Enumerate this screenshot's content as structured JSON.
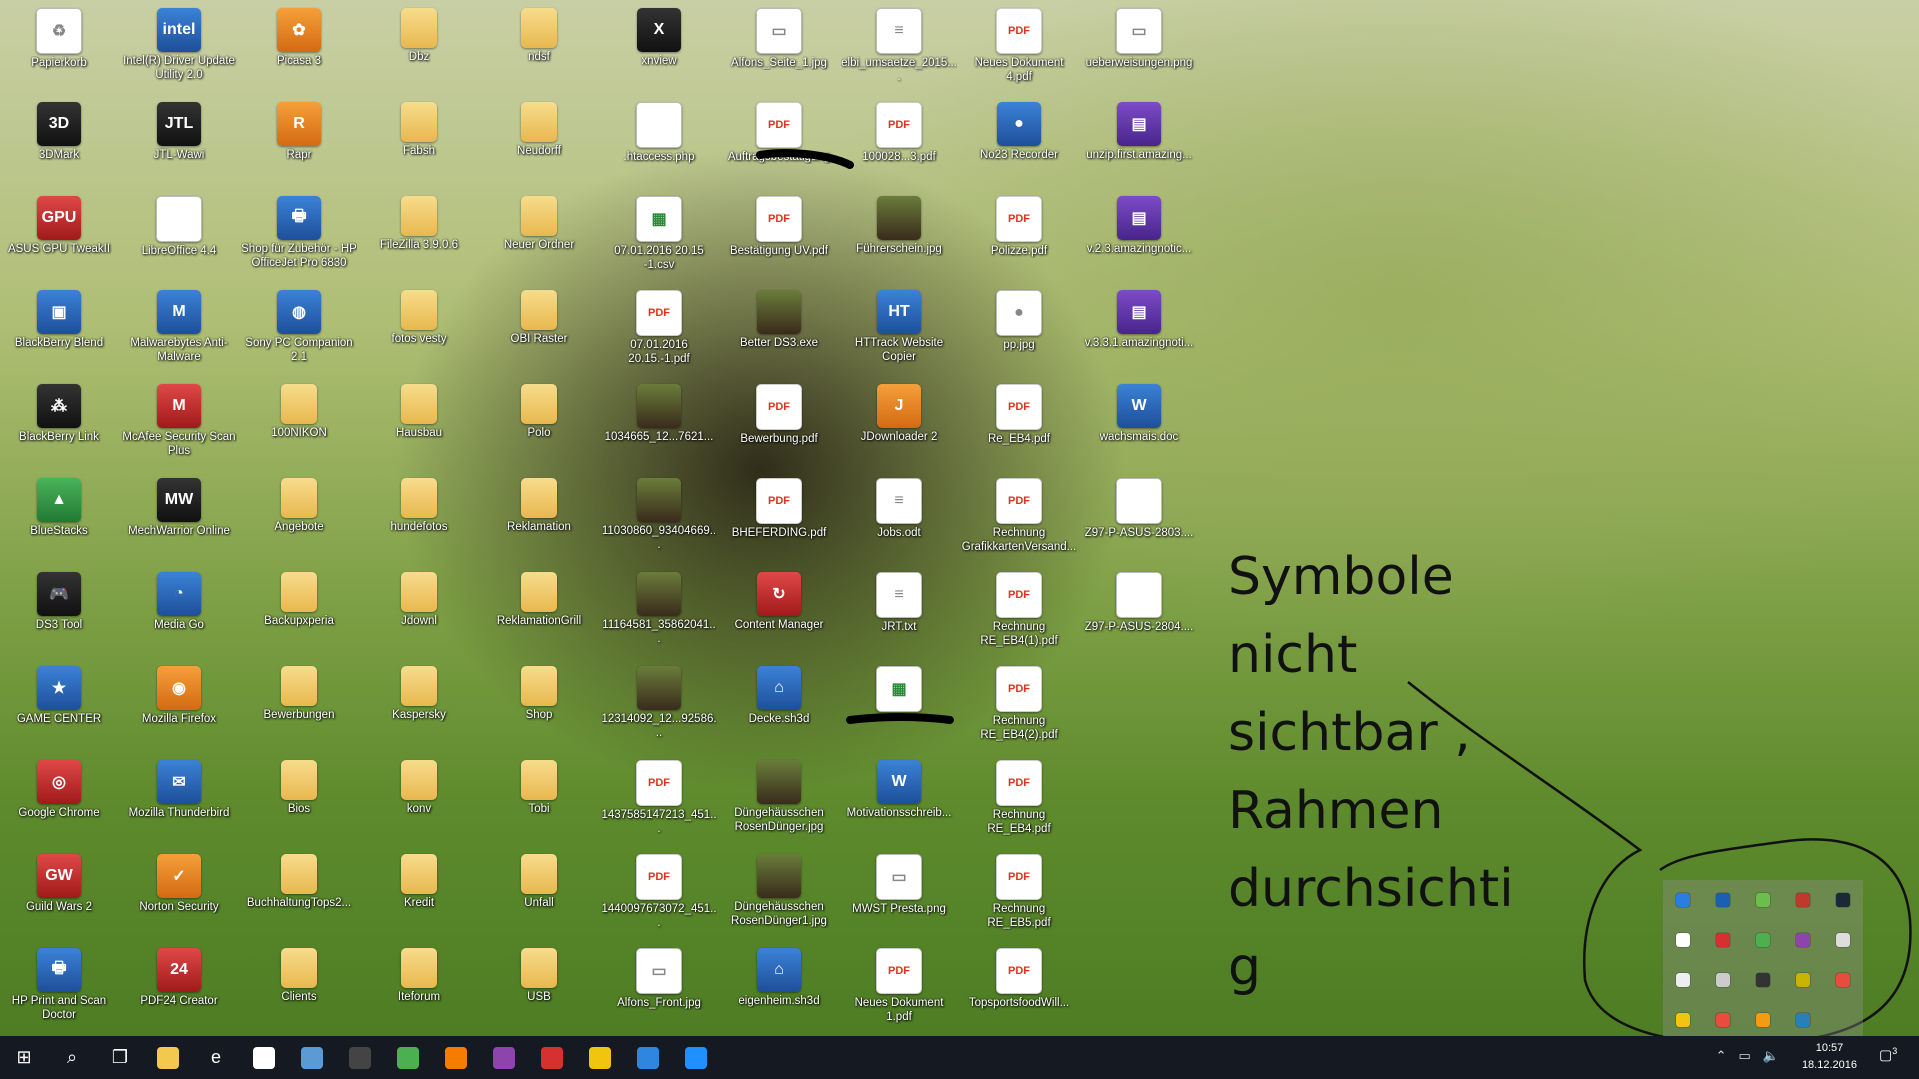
{
  "desktop": {
    "icons": [
      {
        "label": "Papierkorb",
        "col": 0,
        "row": 0,
        "kind": "g-doc",
        "glyph": "♻"
      },
      {
        "label": "Intel(R) Driver Update Utility 2.0",
        "col": 1,
        "row": 0,
        "kind": "g-app",
        "glyph": "intel"
      },
      {
        "label": "Picasa 3",
        "col": 2,
        "row": 0,
        "kind": "g-orange",
        "glyph": "✿"
      },
      {
        "label": "Dbz",
        "col": 3,
        "row": 0,
        "kind": "g-folder",
        "glyph": ""
      },
      {
        "label": "ndsf",
        "col": 4,
        "row": 0,
        "kind": "g-folder",
        "glyph": ""
      },
      {
        "label": "xnview",
        "col": 5,
        "row": 0,
        "kind": "g-dark",
        "glyph": "X"
      },
      {
        "label": "Alfons_Seite_1.jpg",
        "col": 6,
        "row": 0,
        "kind": "g-doc",
        "glyph": "▭"
      },
      {
        "label": "elbi_umsaetze_2015....",
        "col": 7,
        "row": 0,
        "kind": "g-doc",
        "glyph": "≡"
      },
      {
        "label": "Neues Dokument 4.pdf",
        "col": 8,
        "row": 0,
        "kind": "g-pdf",
        "glyph": "PDF"
      },
      {
        "label": "ueberweisungen.png",
        "col": 9,
        "row": 0,
        "kind": "g-doc",
        "glyph": "▭"
      },
      {
        "label": "3DMark",
        "col": 0,
        "row": 1,
        "kind": "g-dark",
        "glyph": "3D"
      },
      {
        "label": "JTL-Wawi",
        "col": 1,
        "row": 1,
        "kind": "g-dark",
        "glyph": "JTL"
      },
      {
        "label": "Rapr",
        "col": 2,
        "row": 1,
        "kind": "g-orange",
        "glyph": "R"
      },
      {
        "label": "Fabsh",
        "col": 3,
        "row": 1,
        "kind": "g-folder",
        "glyph": ""
      },
      {
        "label": "Neudorff",
        "col": 4,
        "row": 1,
        "kind": "g-folder",
        "glyph": ""
      },
      {
        "label": ".htaccess.php",
        "col": 5,
        "row": 1,
        "kind": "g-doc",
        "glyph": ""
      },
      {
        "label": "Auftragsbestätigung",
        "col": 6,
        "row": 1,
        "kind": "g-pdf",
        "glyph": "PDF"
      },
      {
        "label": "100028...3.pdf",
        "col": 7,
        "row": 1,
        "kind": "g-pdf",
        "glyph": "PDF"
      },
      {
        "label": "No23 Recorder",
        "col": 8,
        "row": 1,
        "kind": "g-app",
        "glyph": "●"
      },
      {
        "label": "unzip.first.amazing...",
        "col": 9,
        "row": 1,
        "kind": "g-purple",
        "glyph": "▤"
      },
      {
        "label": "ASUS GPU TweakII",
        "col": 0,
        "row": 2,
        "kind": "g-red",
        "glyph": "GPU"
      },
      {
        "label": "LibreOffice 4.4",
        "col": 1,
        "row": 2,
        "kind": "g-doc",
        "glyph": ""
      },
      {
        "label": "Shop für Zubehör - HP OfficeJet Pro 6830",
        "col": 2,
        "row": 2,
        "kind": "g-app",
        "glyph": "🖶"
      },
      {
        "label": "FileZilla 3.9.0.6",
        "col": 3,
        "row": 2,
        "kind": "g-folder",
        "glyph": ""
      },
      {
        "label": "Neuer Ordner",
        "col": 4,
        "row": 2,
        "kind": "g-folder",
        "glyph": ""
      },
      {
        "label": "07.01.2016 20.15 -1.csv",
        "col": 5,
        "row": 2,
        "kind": "g-sheet",
        "glyph": "▦"
      },
      {
        "label": "Bestätigung UV.pdf",
        "col": 6,
        "row": 2,
        "kind": "g-pdf",
        "glyph": "PDF"
      },
      {
        "label": "Führerschein.jpg",
        "col": 7,
        "row": 2,
        "kind": "g-img",
        "glyph": ""
      },
      {
        "label": "Polizze.pdf",
        "col": 8,
        "row": 2,
        "kind": "g-pdf",
        "glyph": "PDF"
      },
      {
        "label": "v.2.3.amazingnotic...",
        "col": 9,
        "row": 2,
        "kind": "g-purple",
        "glyph": "▤"
      },
      {
        "label": "BlackBerry Blend",
        "col": 0,
        "row": 3,
        "kind": "g-app",
        "glyph": "▣"
      },
      {
        "label": "Malwarebytes Anti-Malware",
        "col": 1,
        "row": 3,
        "kind": "g-app",
        "glyph": "M"
      },
      {
        "label": "Sony PC Companion 2.1",
        "col": 2,
        "row": 3,
        "kind": "g-app",
        "glyph": "◍"
      },
      {
        "label": "fotos vesty",
        "col": 3,
        "row": 3,
        "kind": "g-folder",
        "glyph": ""
      },
      {
        "label": "OBI Raster",
        "col": 4,
        "row": 3,
        "kind": "g-folder",
        "glyph": ""
      },
      {
        "label": "07.01.2016 20.15.-1.pdf",
        "col": 5,
        "row": 3,
        "kind": "g-pdf",
        "glyph": "PDF"
      },
      {
        "label": "Better DS3.exe",
        "col": 6,
        "row": 3,
        "kind": "g-img",
        "glyph": ""
      },
      {
        "label": "HTTrack Website Copier",
        "col": 7,
        "row": 3,
        "kind": "g-app",
        "glyph": "HT"
      },
      {
        "label": "pp.jpg",
        "col": 8,
        "row": 3,
        "kind": "g-doc",
        "glyph": "●"
      },
      {
        "label": "v.3.3.1.amazingnoti...",
        "col": 9,
        "row": 3,
        "kind": "g-purple",
        "glyph": "▤"
      },
      {
        "label": "BlackBerry Link",
        "col": 0,
        "row": 4,
        "kind": "g-dark",
        "glyph": "⁂"
      },
      {
        "label": "McAfee Security Scan Plus",
        "col": 1,
        "row": 4,
        "kind": "g-red",
        "glyph": "M"
      },
      {
        "label": "100NIKON",
        "col": 2,
        "row": 4,
        "kind": "g-folder",
        "glyph": ""
      },
      {
        "label": "Hausbau",
        "col": 3,
        "row": 4,
        "kind": "g-folder",
        "glyph": ""
      },
      {
        "label": "Polo",
        "col": 4,
        "row": 4,
        "kind": "g-folder",
        "glyph": ""
      },
      {
        "label": "1034665_12...7621...",
        "col": 5,
        "row": 4,
        "kind": "g-img",
        "glyph": ""
      },
      {
        "label": "Bewerbung.pdf",
        "col": 6,
        "row": 4,
        "kind": "g-pdf",
        "glyph": "PDF"
      },
      {
        "label": "JDownloader 2",
        "col": 7,
        "row": 4,
        "kind": "g-orange",
        "glyph": "J"
      },
      {
        "label": "Re_EB4.pdf",
        "col": 8,
        "row": 4,
        "kind": "g-pdf",
        "glyph": "PDF"
      },
      {
        "label": "wachsmais.doc",
        "col": 9,
        "row": 4,
        "kind": "g-app",
        "glyph": "W"
      },
      {
        "label": "BlueStacks",
        "col": 0,
        "row": 5,
        "kind": "g-green",
        "glyph": "▲"
      },
      {
        "label": "MechWarrior Online",
        "col": 1,
        "row": 5,
        "kind": "g-dark",
        "glyph": "MW"
      },
      {
        "label": "Angebote",
        "col": 2,
        "row": 5,
        "kind": "g-folder",
        "glyph": ""
      },
      {
        "label": "hundefotos",
        "col": 3,
        "row": 5,
        "kind": "g-folder",
        "glyph": ""
      },
      {
        "label": "Reklamation",
        "col": 4,
        "row": 5,
        "kind": "g-folder",
        "glyph": ""
      },
      {
        "label": "11030860_93404669...",
        "col": 5,
        "row": 5,
        "kind": "g-img",
        "glyph": ""
      },
      {
        "label": "BHEFERDING.pdf",
        "col": 6,
        "row": 5,
        "kind": "g-pdf",
        "glyph": "PDF"
      },
      {
        "label": "Jobs.odt",
        "col": 7,
        "row": 5,
        "kind": "g-doc",
        "glyph": "≡"
      },
      {
        "label": "Rechnung GrafikkartenVersand...",
        "col": 8,
        "row": 5,
        "kind": "g-pdf",
        "glyph": "PDF"
      },
      {
        "label": "Z97-P-ASUS-2803....",
        "col": 9,
        "row": 5,
        "kind": "g-doc",
        "glyph": ""
      },
      {
        "label": "DS3 Tool",
        "col": 0,
        "row": 6,
        "kind": "g-dark",
        "glyph": "🎮"
      },
      {
        "label": "Media Go",
        "col": 1,
        "row": 6,
        "kind": "g-app",
        "glyph": "◔"
      },
      {
        "label": "Backupxperia",
        "col": 2,
        "row": 6,
        "kind": "g-folder",
        "glyph": ""
      },
      {
        "label": "Jdownl",
        "col": 3,
        "row": 6,
        "kind": "g-folder",
        "glyph": ""
      },
      {
        "label": "ReklamationGrill",
        "col": 4,
        "row": 6,
        "kind": "g-folder",
        "glyph": ""
      },
      {
        "label": "11164581_35862041...",
        "col": 5,
        "row": 6,
        "kind": "g-img",
        "glyph": ""
      },
      {
        "label": "Content Manager",
        "col": 6,
        "row": 6,
        "kind": "g-red",
        "glyph": "↻"
      },
      {
        "label": "JRT.txt",
        "col": 7,
        "row": 6,
        "kind": "g-doc",
        "glyph": "≡"
      },
      {
        "label": "Rechnung RE_EB4(1).pdf",
        "col": 8,
        "row": 6,
        "kind": "g-pdf",
        "glyph": "PDF"
      },
      {
        "label": "Z97-P-ASUS-2804....",
        "col": 9,
        "row": 6,
        "kind": "g-doc",
        "glyph": ""
      },
      {
        "label": "GAME CENTER",
        "col": 0,
        "row": 7,
        "kind": "g-app",
        "glyph": "★"
      },
      {
        "label": "Mozilla Firefox",
        "col": 1,
        "row": 7,
        "kind": "g-orange",
        "glyph": "◉"
      },
      {
        "label": "Bewerbungen",
        "col": 2,
        "row": 7,
        "kind": "g-folder",
        "glyph": ""
      },
      {
        "label": "Kaspersky",
        "col": 3,
        "row": 7,
        "kind": "g-folder",
        "glyph": ""
      },
      {
        "label": "Shop",
        "col": 4,
        "row": 7,
        "kind": "g-folder",
        "glyph": ""
      },
      {
        "label": "12314092_12...92586...",
        "col": 5,
        "row": 7,
        "kind": "g-img",
        "glyph": ""
      },
      {
        "label": "Decke.sh3d",
        "col": 6,
        "row": 7,
        "kind": "g-app",
        "glyph": "⌂"
      },
      {
        "label": "",
        "col": 7,
        "row": 7,
        "kind": "g-sheet",
        "glyph": "▦"
      },
      {
        "label": "Rechnung RE_EB4(2).pdf",
        "col": 8,
        "row": 7,
        "kind": "g-pdf",
        "glyph": "PDF"
      },
      {
        "label": "Google Chrome",
        "col": 0,
        "row": 8,
        "kind": "g-red",
        "glyph": "◎"
      },
      {
        "label": "Mozilla Thunderbird",
        "col": 1,
        "row": 8,
        "kind": "g-app",
        "glyph": "✉"
      },
      {
        "label": "Bios",
        "col": 2,
        "row": 8,
        "kind": "g-folder",
        "glyph": ""
      },
      {
        "label": "konv",
        "col": 3,
        "row": 8,
        "kind": "g-folder",
        "glyph": ""
      },
      {
        "label": "Tobi",
        "col": 4,
        "row": 8,
        "kind": "g-folder",
        "glyph": ""
      },
      {
        "label": "1437585147213_451...",
        "col": 5,
        "row": 8,
        "kind": "g-pdf",
        "glyph": "PDF"
      },
      {
        "label": "Düngehäusschen RosenDünger.jpg",
        "col": 6,
        "row": 8,
        "kind": "g-img",
        "glyph": ""
      },
      {
        "label": "Motivationsschreib...",
        "col": 7,
        "row": 8,
        "kind": "g-app",
        "glyph": "W"
      },
      {
        "label": "Rechnung RE_EB4.pdf",
        "col": 8,
        "row": 8,
        "kind": "g-pdf",
        "glyph": "PDF"
      },
      {
        "label": "Guild Wars 2",
        "col": 0,
        "row": 9,
        "kind": "g-red",
        "glyph": "GW"
      },
      {
        "label": "Norton Security",
        "col": 1,
        "row": 9,
        "kind": "g-orange",
        "glyph": "✓"
      },
      {
        "label": "BuchhaltungTops2...",
        "col": 2,
        "row": 9,
        "kind": "g-folder",
        "glyph": ""
      },
      {
        "label": "Kredit",
        "col": 3,
        "row": 9,
        "kind": "g-folder",
        "glyph": ""
      },
      {
        "label": "Unfall",
        "col": 4,
        "row": 9,
        "kind": "g-folder",
        "glyph": ""
      },
      {
        "label": "1440097673072_451...",
        "col": 5,
        "row": 9,
        "kind": "g-pdf",
        "glyph": "PDF"
      },
      {
        "label": "Düngehäusschen RosenDünger1.jpg",
        "col": 6,
        "row": 9,
        "kind": "g-img",
        "glyph": ""
      },
      {
        "label": "MWST Presta.png",
        "col": 7,
        "row": 9,
        "kind": "g-doc",
        "glyph": "▭"
      },
      {
        "label": "Rechnung RE_EB5.pdf",
        "col": 8,
        "row": 9,
        "kind": "g-pdf",
        "glyph": "PDF"
      },
      {
        "label": "HP Print and Scan Doctor",
        "col": 0,
        "row": 10,
        "kind": "g-app",
        "glyph": "🖶"
      },
      {
        "label": "PDF24 Creator",
        "col": 1,
        "row": 10,
        "kind": "g-red",
        "glyph": "24"
      },
      {
        "label": "Clients",
        "col": 2,
        "row": 10,
        "kind": "g-folder",
        "glyph": ""
      },
      {
        "label": "Iteforum",
        "col": 3,
        "row": 10,
        "kind": "g-folder",
        "glyph": ""
      },
      {
        "label": "USB",
        "col": 4,
        "row": 10,
        "kind": "g-folder",
        "glyph": ""
      },
      {
        "label": "Alfons_Front.jpg",
        "col": 5,
        "row": 10,
        "kind": "g-doc",
        "glyph": "▭"
      },
      {
        "label": "eigenheim.sh3d",
        "col": 6,
        "row": 10,
        "kind": "g-app",
        "glyph": "⌂"
      },
      {
        "label": "Neues Dokument 1.pdf",
        "col": 7,
        "row": 10,
        "kind": "g-pdf",
        "glyph": "PDF"
      },
      {
        "label": "TopsportsfoodWill...",
        "col": 8,
        "row": 10,
        "kind": "g-pdf",
        "glyph": "PDF"
      }
    ]
  },
  "annotation": {
    "lines": [
      "Symbole",
      "nicht",
      "sichtbar ,",
      "Rahmen",
      "durchsichti",
      "g"
    ]
  },
  "tray_flyout": {
    "icons": [
      {
        "name": "tray-icon-1",
        "color": "#2a7de1"
      },
      {
        "name": "tray-icon-2",
        "color": "#1a5fb4"
      },
      {
        "name": "tray-icon-3",
        "color": "#6abf4b"
      },
      {
        "name": "tray-icon-4",
        "color": "#c0392b"
      },
      {
        "name": "tray-icon-steam",
        "color": "#1b2838"
      },
      {
        "name": "tray-icon-6",
        "color": "#ffffff"
      },
      {
        "name": "tray-icon-7",
        "color": "#d63031"
      },
      {
        "name": "tray-icon-chrome",
        "color": "#4caf50"
      },
      {
        "name": "tray-icon-9",
        "color": "#8e44ad"
      },
      {
        "name": "tray-icon-usb",
        "color": "#dddddd"
      },
      {
        "name": "tray-icon-11",
        "color": "#eeeeee"
      },
      {
        "name": "tray-icon-12",
        "color": "#cccccc"
      },
      {
        "name": "tray-icon-13",
        "color": "#333333"
      },
      {
        "name": "tray-icon-14",
        "color": "#c8b400"
      },
      {
        "name": "tray-icon-15",
        "color": "#e74c3c"
      },
      {
        "name": "tray-icon-norton",
        "color": "#f1c40f"
      },
      {
        "name": "tray-icon-17",
        "color": "#e74c3c"
      },
      {
        "name": "tray-icon-18",
        "color": "#f39c12"
      },
      {
        "name": "tray-icon-19",
        "color": "#2980b9"
      }
    ]
  },
  "taskbar": {
    "pinned": [
      {
        "name": "start-button",
        "glyph": "⊞",
        "color": ""
      },
      {
        "name": "search-button",
        "glyph": "⌕",
        "color": ""
      },
      {
        "name": "task-view-button",
        "glyph": "❐",
        "color": ""
      },
      {
        "name": "file-explorer-icon",
        "glyph": "",
        "color": "#f2c94c"
      },
      {
        "name": "edge-icon",
        "glyph": "e",
        "color": "#1e88e5"
      },
      {
        "name": "store-icon",
        "glyph": "",
        "color": "#ffffff"
      },
      {
        "name": "pinned-app-icon",
        "glyph": "",
        "color": "#5b9bd5"
      },
      {
        "name": "controller-icon",
        "glyph": "",
        "color": "#444444"
      },
      {
        "name": "chrome-icon",
        "glyph": "",
        "color": "#4caf50"
      },
      {
        "name": "firefox-icon",
        "glyph": "",
        "color": "#f57c00"
      },
      {
        "name": "purple-app-icon",
        "glyph": "",
        "color": "#8e44ad"
      },
      {
        "name": "red-app-icon",
        "glyph": "",
        "color": "#d63031"
      },
      {
        "name": "norton-icon",
        "glyph": "",
        "color": "#f1c40f"
      },
      {
        "name": "thunderbird-icon",
        "glyph": "",
        "color": "#2e86de"
      },
      {
        "name": "malwarebytes-icon",
        "glyph": "",
        "color": "#1e90ff"
      }
    ],
    "time": "10:57",
    "date": "18.12.2016",
    "notification_count": "3"
  }
}
